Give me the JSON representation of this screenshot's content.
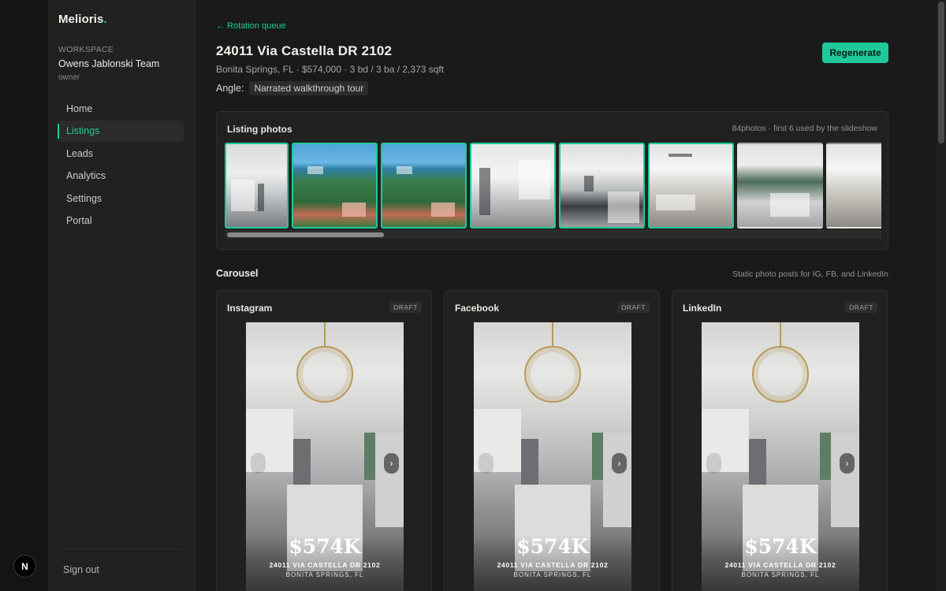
{
  "brand": {
    "name": "Melioris",
    "dot": "."
  },
  "workspace": {
    "label": "WORKSPACE",
    "name": "Owens Jablonski Team",
    "role": "owner"
  },
  "nav": [
    {
      "label": "Home",
      "active": false
    },
    {
      "label": "Listings",
      "active": true
    },
    {
      "label": "Leads",
      "active": false
    },
    {
      "label": "Analytics",
      "active": false
    },
    {
      "label": "Settings",
      "active": false
    },
    {
      "label": "Portal",
      "active": false
    }
  ],
  "sidebar": {
    "signout": "Sign out",
    "badge": "N"
  },
  "header": {
    "back": "← Rotation queue",
    "title": "24011 Via Castella DR 2102",
    "subtitle": "Bonita Springs, FL · $574,000 · 3 bd / 3 ba / 2,373 sqft",
    "angle_label": "Angle:",
    "angle_value": "Narrated walkthrough tour",
    "regenerate": "Regenerate"
  },
  "photos": {
    "title": "Listing photos",
    "note": "84photos · first 6 used by the slideshow",
    "thumbs": [
      {
        "kind": "kitchen",
        "used": true
      },
      {
        "kind": "aerial",
        "used": true
      },
      {
        "kind": "aerial",
        "used": true
      },
      {
        "kind": "hall",
        "used": true
      },
      {
        "kind": "kitchen2",
        "used": true
      },
      {
        "kind": "living",
        "used": true
      },
      {
        "kind": "window",
        "used": false
      },
      {
        "kind": "living",
        "used": false
      }
    ]
  },
  "carousel": {
    "title": "Carousel",
    "note": "Static photo posts for IG, FB, and LinkedIn",
    "cards": [
      {
        "platform": "Instagram",
        "status": "DRAFT",
        "price": "$574K",
        "address": "24011 VIA CASTELLA DR 2102",
        "city": "BONITA SPRINGS, FL"
      },
      {
        "platform": "Facebook",
        "status": "DRAFT",
        "price": "$574K",
        "address": "24011 VIA CASTELLA DR 2102",
        "city": "BONITA SPRINGS, FL"
      },
      {
        "platform": "LinkedIn",
        "status": "DRAFT",
        "price": "$574K",
        "address": "24011 VIA CASTELLA DR 2102",
        "city": "BONITA SPRINGS, FL"
      }
    ]
  },
  "colors": {
    "accent": "#1fc99a",
    "background": "#1a1a1a",
    "panel": "#212120"
  },
  "icons": {
    "prev": "chevron-left-icon",
    "next": "chevron-right-icon",
    "back": "arrow-left-icon"
  }
}
